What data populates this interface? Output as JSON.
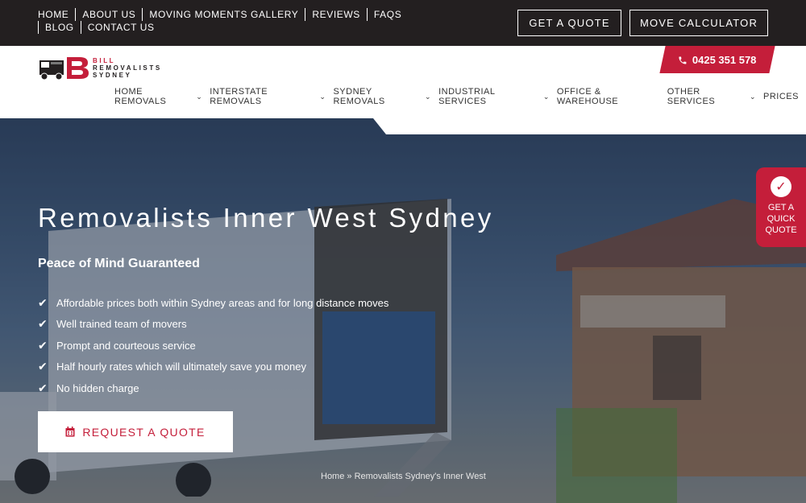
{
  "topnav": {
    "items": [
      "HOME",
      "ABOUT US",
      "MOVING MOMENTS GALLERY",
      "REVIEWS",
      "FAQS",
      "BLOG",
      "CONTACT US"
    ]
  },
  "buttons": {
    "get_quote": "GET A QUOTE",
    "move_calculator": "MOVE CALCULATOR"
  },
  "logo": {
    "line1": "BILL",
    "line2": "REMOVALISTS",
    "line3": "SYDNEY"
  },
  "phone": {
    "number": "0425 351 578",
    "icon": "phone-icon"
  },
  "mainnav": {
    "items": [
      {
        "label": "HOME REMOVALS",
        "dropdown": true
      },
      {
        "label": "INTERSTATE REMOVALS",
        "dropdown": true
      },
      {
        "label": "SYDNEY REMOVALS",
        "dropdown": true
      },
      {
        "label": "INDUSTRIAL SERVICES",
        "dropdown": true
      },
      {
        "label": "OFFICE & WAREHOUSE",
        "dropdown": false
      },
      {
        "label": "OTHER SERVICES",
        "dropdown": true
      },
      {
        "label": "PRICES",
        "dropdown": false
      }
    ]
  },
  "hero": {
    "title": "Removalists Inner West Sydney",
    "subtitle": "Peace of Mind Guaranteed",
    "bullets": [
      "Affordable prices both within Sydney areas and for long distance moves",
      "Well trained team of movers",
      "Prompt and courteous service",
      "Half hourly rates which will ultimately save you money",
      "No hidden charge"
    ],
    "cta": "REQUEST A QUOTE",
    "breadcrumb": "Home » Removalists Sydney's Inner West"
  },
  "side_quote": {
    "line1": "GET A",
    "line2": "QUICK",
    "line3": "QUOTE"
  },
  "colors": {
    "brand_red": "#c41e3a",
    "dark": "#231f20"
  }
}
